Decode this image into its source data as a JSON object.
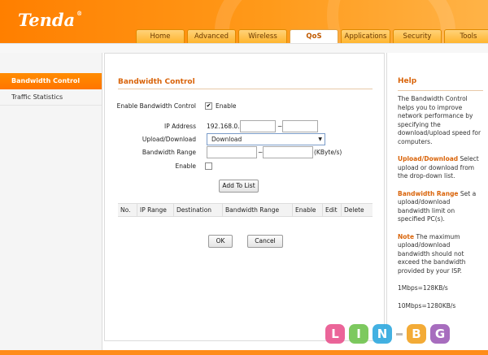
{
  "brand": {
    "logo_text": "Tenda",
    "reg": "®"
  },
  "tabs": [
    {
      "label": "Home"
    },
    {
      "label": "Advanced"
    },
    {
      "label": "Wireless"
    },
    {
      "label": "QoS"
    },
    {
      "label": "Applications"
    },
    {
      "label": "Security"
    },
    {
      "label": "Tools"
    }
  ],
  "active_tab": "QoS",
  "sidebar": {
    "items": [
      {
        "label": "Bandwidth Control"
      },
      {
        "label": "Traffic Statistics"
      }
    ]
  },
  "main": {
    "title": "Bandwidth Control",
    "enable_label": "Enable Bandwidth Control",
    "enable_text": "Enable",
    "enable_checked": true,
    "ip_label": "IP Address",
    "ip_prefix": "192.168.0.",
    "ip_separator": "~",
    "updown_label": "Upload/Download",
    "updown_value": "Download",
    "range_label": "Bandwidth Range",
    "range_separator": "~",
    "range_unit": "(KByte/s)",
    "rule_enable_label": "Enable",
    "add_button": "Add To List",
    "table_headers": [
      "No.",
      "IP Range",
      "Destination",
      "Bandwidth Range",
      "Enable",
      "Edit",
      "Delete"
    ],
    "ok_button": "OK",
    "cancel_button": "Cancel"
  },
  "help": {
    "title": "Help",
    "p1": "The Bandwidth Control helps you to improve network performance by specifying the download/upload speed for computers.",
    "p2_kw": "Upload/Download",
    "p2": " Select upload or download from the drop-down list.",
    "p3_kw": "Bandwidth Range",
    "p3": " Set a upload/download bandwidth limit on specified PC(s).",
    "p4_kw": "Note",
    "p4": " The maximum upload/download bandwidth should not exceed the bandwidth provided by your ISP.",
    "p5": "1Mbps=128KB/s",
    "p6": "10Mbps=1280KB/s"
  },
  "watermark": {
    "letters": [
      "L",
      "I",
      "N",
      "B",
      "G"
    ],
    "colors": [
      "#e9508c",
      "#6cc24a",
      "#2aa7df",
      "#f2a01c",
      "#9b59b6"
    ]
  }
}
